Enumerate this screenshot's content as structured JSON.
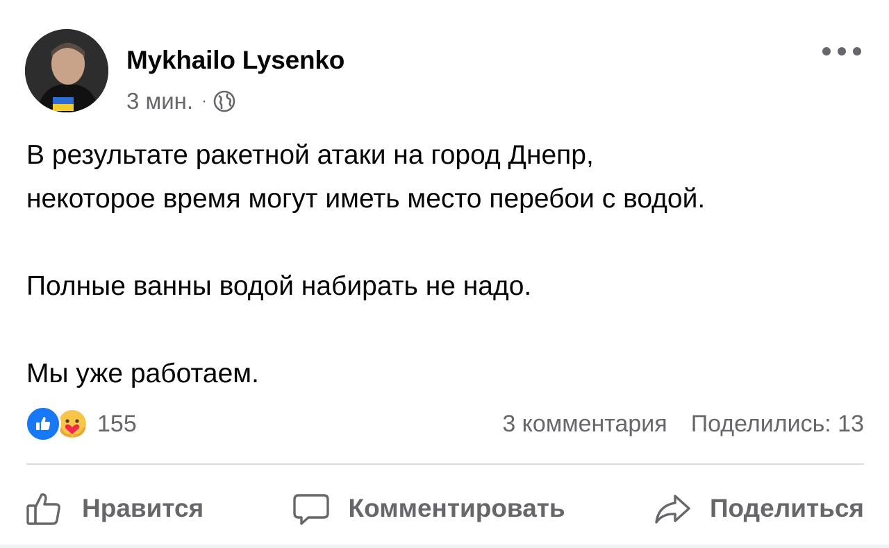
{
  "post": {
    "author": "Mykhailo Lysenko",
    "time": "3 мин.",
    "separator": "·",
    "audience_icon": "globe-icon",
    "more_icon": "more-horizontal-icon",
    "paragraphs": [
      "В результате ракетной атаки на город Днепр,",
      "некоторое время могут иметь место перебои с водой.",
      "Полные ванны водой набирать не надо.",
      "Мы уже работаем."
    ]
  },
  "stats": {
    "reaction_icons": [
      "like-icon",
      "care-icon"
    ],
    "reactions_count": "155",
    "comments": "3 комментария",
    "shares": "Поделились: 13"
  },
  "actions": {
    "like": "Нравится",
    "comment": "Комментировать",
    "share": "Поделиться"
  },
  "colors": {
    "text": "#050505",
    "secondary": "#65676b",
    "like_blue": "#1877f2",
    "divider": "#dcdde0"
  }
}
